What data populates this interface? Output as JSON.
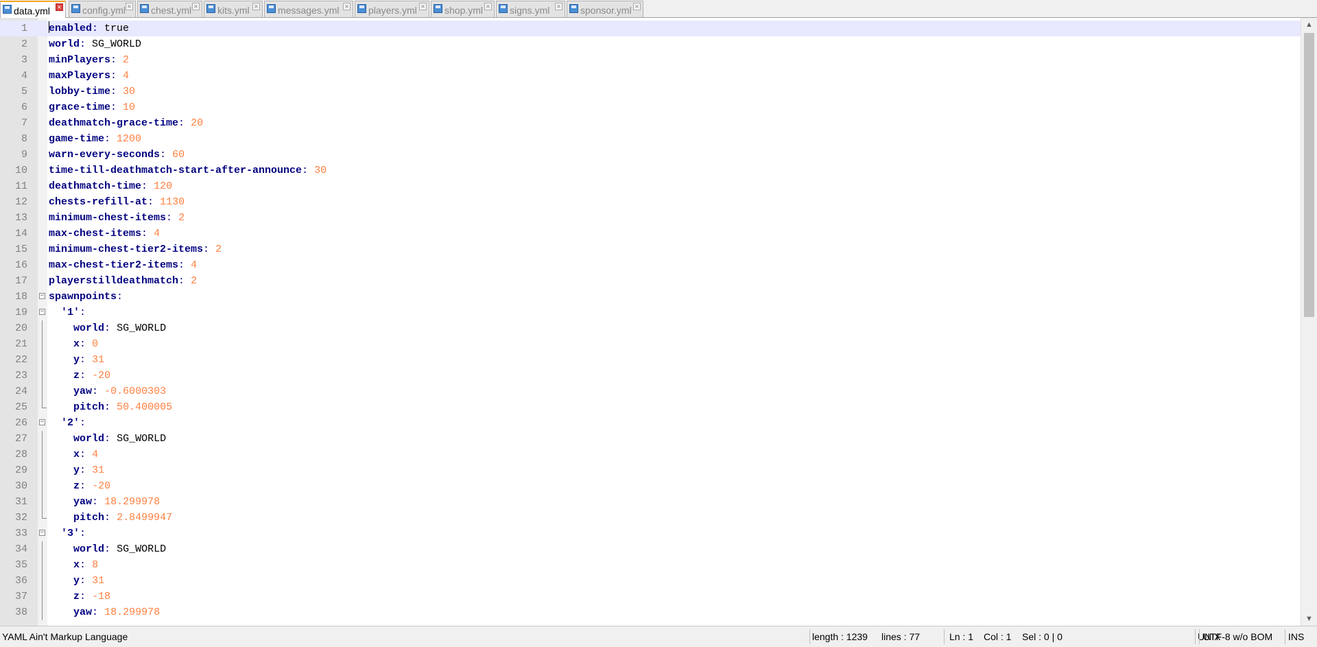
{
  "tabs": [
    {
      "label": "data.yml",
      "active": true
    },
    {
      "label": "config.yml",
      "active": false
    },
    {
      "label": "chest.yml",
      "active": false
    },
    {
      "label": "kits.yml",
      "active": false
    },
    {
      "label": "messages.yml",
      "active": false
    },
    {
      "label": "players.yml",
      "active": false
    },
    {
      "label": "shop.yml",
      "active": false
    },
    {
      "label": "signs.yml",
      "active": false
    },
    {
      "label": "sponsor.yml",
      "active": false
    }
  ],
  "editor": {
    "lines": [
      {
        "n": "1",
        "key": "enabled",
        "value": "true",
        "type": "text",
        "indent": 0
      },
      {
        "n": "2",
        "key": "world",
        "value": "SG_WORLD",
        "type": "text",
        "indent": 0
      },
      {
        "n": "3",
        "key": "minPlayers",
        "value": "2",
        "type": "num",
        "indent": 0
      },
      {
        "n": "4",
        "key": "maxPlayers",
        "value": "4",
        "type": "num",
        "indent": 0
      },
      {
        "n": "5",
        "key": "lobby-time",
        "value": "30",
        "type": "num",
        "indent": 0
      },
      {
        "n": "6",
        "key": "grace-time",
        "value": "10",
        "type": "num",
        "indent": 0
      },
      {
        "n": "7",
        "key": "deathmatch-grace-time",
        "value": "20",
        "type": "num",
        "indent": 0
      },
      {
        "n": "8",
        "key": "game-time",
        "value": "1200",
        "type": "num",
        "indent": 0
      },
      {
        "n": "9",
        "key": "warn-every-seconds",
        "value": "60",
        "type": "num",
        "indent": 0
      },
      {
        "n": "10",
        "key": "time-till-deathmatch-start-after-announce",
        "value": "30",
        "type": "num",
        "indent": 0
      },
      {
        "n": "11",
        "key": "deathmatch-time",
        "value": "120",
        "type": "num",
        "indent": 0
      },
      {
        "n": "12",
        "key": "chests-refill-at",
        "value": "1130",
        "type": "num",
        "indent": 0
      },
      {
        "n": "13",
        "key": "minimum-chest-items",
        "value": "2",
        "type": "num",
        "indent": 0
      },
      {
        "n": "14",
        "key": "max-chest-items",
        "value": "4",
        "type": "num",
        "indent": 0
      },
      {
        "n": "15",
        "key": "minimum-chest-tier2-items",
        "value": "2",
        "type": "num",
        "indent": 0
      },
      {
        "n": "16",
        "key": "max-chest-tier2-items",
        "value": "4",
        "type": "num",
        "indent": 0
      },
      {
        "n": "17",
        "key": "playerstilldeathmatch",
        "value": "2",
        "type": "num",
        "indent": 0
      },
      {
        "n": "18",
        "key": "spawnpoints",
        "value": "",
        "type": "text",
        "indent": 0,
        "fold": "open"
      },
      {
        "n": "19",
        "key": "'1'",
        "value": "",
        "type": "text",
        "indent": 1,
        "fold": "open"
      },
      {
        "n": "20",
        "key": "world",
        "value": "SG_WORLD",
        "type": "text",
        "indent": 2,
        "fold": "mid"
      },
      {
        "n": "21",
        "key": "x",
        "value": "0",
        "type": "num",
        "indent": 2,
        "fold": "mid"
      },
      {
        "n": "22",
        "key": "y",
        "value": "31",
        "type": "num",
        "indent": 2,
        "fold": "mid"
      },
      {
        "n": "23",
        "key": "z",
        "value": "-20",
        "type": "num",
        "indent": 2,
        "fold": "mid"
      },
      {
        "n": "24",
        "key": "yaw",
        "value": "-0.6000303",
        "type": "num",
        "indent": 2,
        "fold": "mid"
      },
      {
        "n": "25",
        "key": "pitch",
        "value": "50.400005",
        "type": "num",
        "indent": 2,
        "fold": "end"
      },
      {
        "n": "26",
        "key": "'2'",
        "value": "",
        "type": "text",
        "indent": 1,
        "fold": "open"
      },
      {
        "n": "27",
        "key": "world",
        "value": "SG_WORLD",
        "type": "text",
        "indent": 2,
        "fold": "mid"
      },
      {
        "n": "28",
        "key": "x",
        "value": "4",
        "type": "num",
        "indent": 2,
        "fold": "mid"
      },
      {
        "n": "29",
        "key": "y",
        "value": "31",
        "type": "num",
        "indent": 2,
        "fold": "mid"
      },
      {
        "n": "30",
        "key": "z",
        "value": "-20",
        "type": "num",
        "indent": 2,
        "fold": "mid"
      },
      {
        "n": "31",
        "key": "yaw",
        "value": "18.299978",
        "type": "num",
        "indent": 2,
        "fold": "mid"
      },
      {
        "n": "32",
        "key": "pitch",
        "value": "2.8499947",
        "type": "num",
        "indent": 2,
        "fold": "end"
      },
      {
        "n": "33",
        "key": "'3'",
        "value": "",
        "type": "text",
        "indent": 1,
        "fold": "open"
      },
      {
        "n": "34",
        "key": "world",
        "value": "SG_WORLD",
        "type": "text",
        "indent": 2,
        "fold": "mid"
      },
      {
        "n": "35",
        "key": "x",
        "value": "8",
        "type": "num",
        "indent": 2,
        "fold": "mid"
      },
      {
        "n": "36",
        "key": "y",
        "value": "31",
        "type": "num",
        "indent": 2,
        "fold": "mid"
      },
      {
        "n": "37",
        "key": "z",
        "value": "-18",
        "type": "num",
        "indent": 2,
        "fold": "mid"
      },
      {
        "n": "38",
        "key": "yaw",
        "value": "18.299978",
        "type": "num",
        "indent": 2,
        "fold": "mid"
      }
    ],
    "current_line": "1"
  },
  "statusbar": {
    "language": "YAML Ain't Markup Language",
    "length": "length : 1239",
    "lines": "lines : 77",
    "ln": "Ln : 1",
    "col": "Col : 1",
    "sel": "Sel : 0 | 0",
    "eol": "UNIX",
    "encoding": "UTF-8 w/o BOM",
    "mode": "INS"
  },
  "icons": {
    "file": "file-icon",
    "close": "close-icon",
    "fold_open": "fold-minus-icon",
    "scroll_up": "arrow-up-icon",
    "scroll_down": "arrow-down-icon"
  }
}
